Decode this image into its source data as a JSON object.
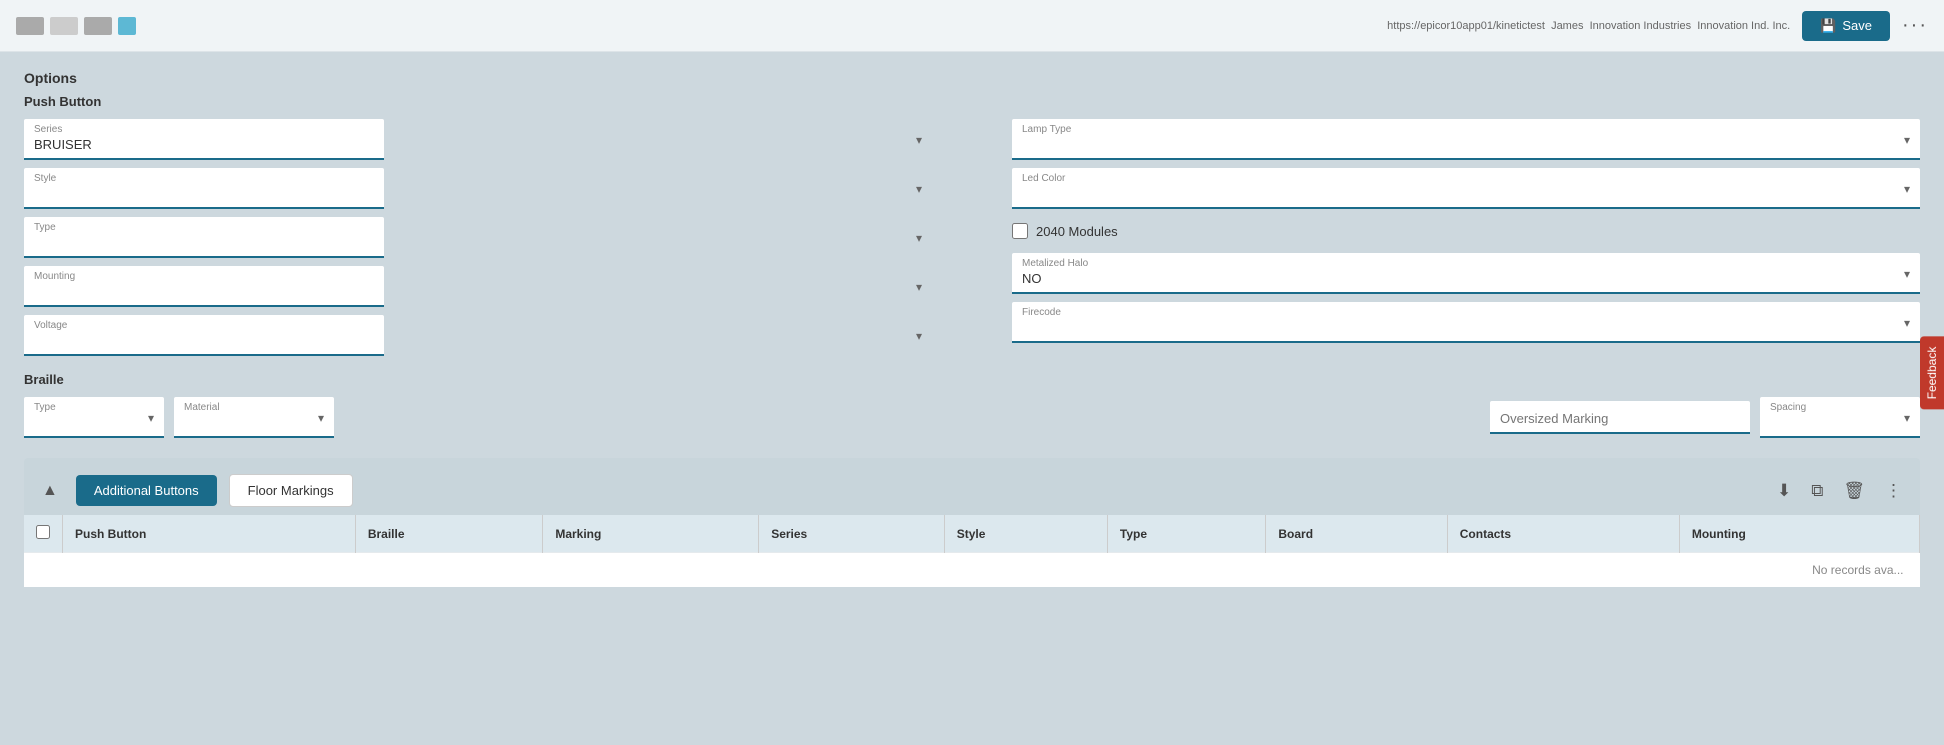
{
  "topbar": {
    "url": "https://epicor10app01/kinetictest",
    "user": "James",
    "company": "Innovation Industries",
    "company2": "Innovation Ind. Inc.",
    "save_label": "Save",
    "more_label": "···"
  },
  "feedback": {
    "label": "Feedback"
  },
  "options": {
    "section_title": "Options",
    "push_button_title": "Push Button",
    "fields": {
      "series_label": "Series",
      "series_value": "BRUISER",
      "style_label": "Style",
      "type_label": "Type",
      "mounting_label": "Mounting",
      "voltage_label": "Voltage",
      "lamp_type_label": "Lamp Type",
      "led_color_label": "Led Color",
      "checkbox_2040": "2040 Modules",
      "metalized_halo_label": "Metalized Halo",
      "metalized_halo_value": "NO",
      "firecode_label": "Firecode"
    }
  },
  "braille": {
    "section_title": "Braille",
    "type_label": "Type",
    "material_label": "Material",
    "oversized_marking_label": "Oversized Marking",
    "oversized_marking_placeholder": "Oversized Marking",
    "spacing_label": "Spacing"
  },
  "buttons": {
    "additional_label": "Additional Buttons",
    "floor_markings_label": "Floor Markings"
  },
  "table": {
    "columns": [
      "Push Button",
      "Braille",
      "Marking",
      "Series",
      "Style",
      "Type",
      "Board",
      "Contacts",
      "Mounting"
    ],
    "no_records": "No records ava..."
  }
}
